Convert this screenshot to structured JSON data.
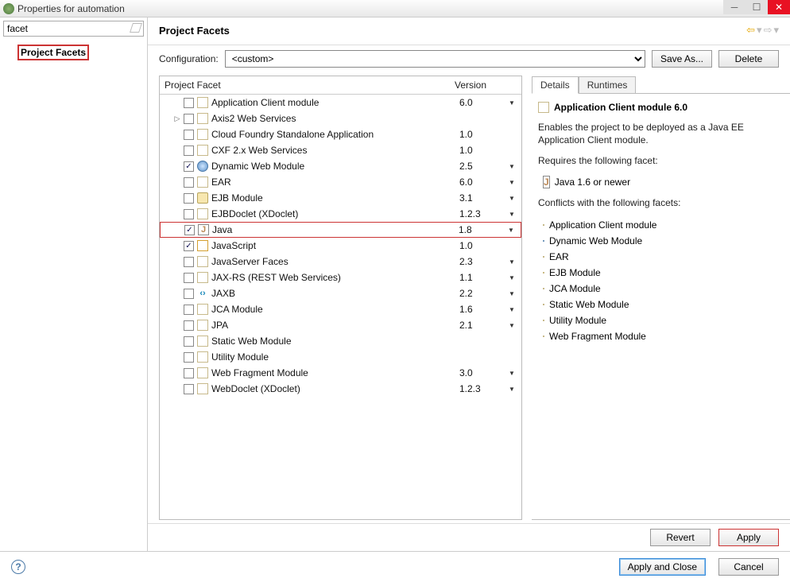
{
  "window": {
    "title": "Properties for automation"
  },
  "sidebar": {
    "filter_value": "facet",
    "nav_label": "Project Facets"
  },
  "header": {
    "title": "Project Facets"
  },
  "config": {
    "label": "Configuration:",
    "value": "<custom>",
    "save_as": "Save As...",
    "delete": "Delete"
  },
  "columns": {
    "facet": "Project Facet",
    "version": "Version"
  },
  "facets": [
    {
      "name": "Application Client module",
      "version": "6.0",
      "checked": false,
      "icon": "file",
      "dd": true
    },
    {
      "name": "Axis2 Web Services",
      "version": "",
      "checked": false,
      "icon": "file",
      "expander": true
    },
    {
      "name": "Cloud Foundry Standalone Application",
      "version": "1.0",
      "checked": false,
      "icon": "file"
    },
    {
      "name": "CXF 2.x Web Services",
      "version": "1.0",
      "checked": false,
      "icon": "file"
    },
    {
      "name": "Dynamic Web Module",
      "version": "2.5",
      "checked": true,
      "icon": "globe",
      "dd": true
    },
    {
      "name": "EAR",
      "version": "6.0",
      "checked": false,
      "icon": "file",
      "dd": true
    },
    {
      "name": "EJB Module",
      "version": "3.1",
      "checked": false,
      "icon": "bean",
      "dd": true
    },
    {
      "name": "EJBDoclet (XDoclet)",
      "version": "1.2.3",
      "checked": false,
      "icon": "file",
      "dd": true
    },
    {
      "name": "Java",
      "version": "1.8",
      "checked": true,
      "icon": "j",
      "dd": true,
      "highlight": true
    },
    {
      "name": "JavaScript",
      "version": "1.0",
      "checked": true,
      "icon": "js"
    },
    {
      "name": "JavaServer Faces",
      "version": "2.3",
      "checked": false,
      "icon": "file",
      "dd": true
    },
    {
      "name": "JAX-RS (REST Web Services)",
      "version": "1.1",
      "checked": false,
      "icon": "file",
      "dd": true
    },
    {
      "name": "JAXB",
      "version": "2.2",
      "checked": false,
      "icon": "jx",
      "dd": true
    },
    {
      "name": "JCA Module",
      "version": "1.6",
      "checked": false,
      "icon": "file",
      "dd": true
    },
    {
      "name": "JPA",
      "version": "2.1",
      "checked": false,
      "icon": "file",
      "dd": true
    },
    {
      "name": "Static Web Module",
      "version": "",
      "checked": false,
      "icon": "file"
    },
    {
      "name": "Utility Module",
      "version": "",
      "checked": false,
      "icon": "file"
    },
    {
      "name": "Web Fragment Module",
      "version": "3.0",
      "checked": false,
      "icon": "file",
      "dd": true
    },
    {
      "name": "WebDoclet (XDoclet)",
      "version": "1.2.3",
      "checked": false,
      "icon": "file",
      "dd": true
    }
  ],
  "details": {
    "tab_details": "Details",
    "tab_runtimes": "Runtimes",
    "title": "Application Client module 6.0",
    "desc": "Enables the project to be deployed as a Java EE Application Client module.",
    "requires_label": "Requires the following facet:",
    "requires": "Java 1.6 or newer",
    "conflicts_label": "Conflicts with the following facets:",
    "conflicts": [
      {
        "name": "Application Client module",
        "icon": "file"
      },
      {
        "name": "Dynamic Web Module",
        "icon": "globe"
      },
      {
        "name": "EAR",
        "icon": "file"
      },
      {
        "name": "EJB Module",
        "icon": "bean"
      },
      {
        "name": "JCA Module",
        "icon": "file"
      },
      {
        "name": "Static Web Module",
        "icon": "file"
      },
      {
        "name": "Utility Module",
        "icon": "file"
      },
      {
        "name": "Web Fragment Module",
        "icon": "file"
      }
    ]
  },
  "buttons": {
    "revert": "Revert",
    "apply": "Apply",
    "apply_close": "Apply and Close",
    "cancel": "Cancel"
  }
}
